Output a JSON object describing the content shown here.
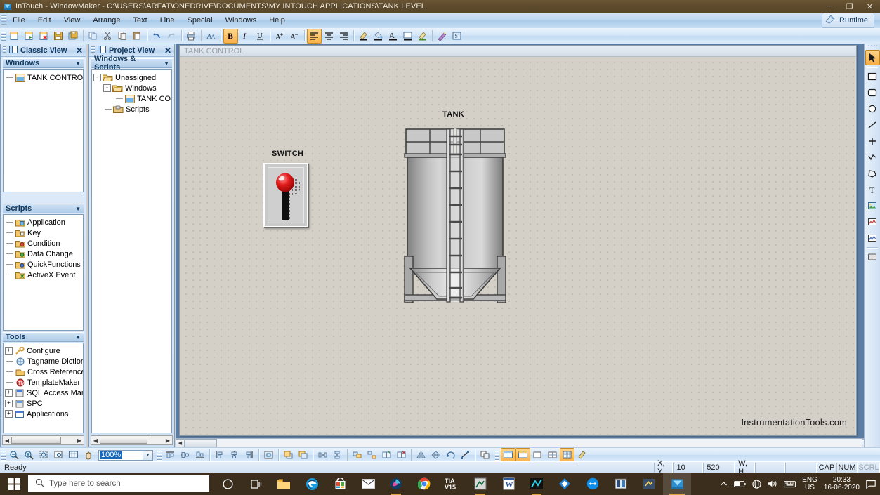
{
  "window": {
    "title": "InTouch - WindowMaker - C:\\USERS\\ARFAT\\ONEDRIVE\\DOCUMENTS\\MY INTOUCH APPLICATIONS\\TANK LEVEL",
    "minimize": "─",
    "maximize": "❐",
    "close": "✕"
  },
  "menu": {
    "items": [
      {
        "label": "File"
      },
      {
        "label": "Edit"
      },
      {
        "label": "View"
      },
      {
        "label": "Arrange"
      },
      {
        "label": "Text"
      },
      {
        "label": "Line"
      },
      {
        "label": "Special"
      },
      {
        "label": "Windows"
      },
      {
        "label": "Help"
      }
    ],
    "runtime_label": "Runtime"
  },
  "toolbar": {
    "groups": [
      {
        "buttons": [
          {
            "name": "new-window-button",
            "icon": "new-window-icon"
          },
          {
            "name": "open-window-button",
            "icon": "open-window-icon"
          },
          {
            "name": "close-window-button",
            "icon": "close-window-icon"
          },
          {
            "name": "save-button",
            "icon": "save-icon"
          },
          {
            "name": "save-all-button",
            "icon": "save-all-icon"
          }
        ]
      },
      {
        "buttons": [
          {
            "name": "duplicate-button",
            "icon": "duplicate-icon"
          },
          {
            "name": "cut-button",
            "icon": "cut-icon"
          },
          {
            "name": "copy-button",
            "icon": "copy-icon"
          },
          {
            "name": "paste-button",
            "icon": "paste-icon"
          }
        ]
      },
      {
        "buttons": [
          {
            "name": "undo-button",
            "icon": "undo-icon"
          },
          {
            "name": "redo-button",
            "icon": "redo-icon"
          }
        ]
      },
      {
        "buttons": [
          {
            "name": "print-button",
            "icon": "print-icon"
          }
        ]
      },
      {
        "buttons": [
          {
            "name": "font-button",
            "icon": "font-icon"
          }
        ]
      },
      {
        "buttons": [
          {
            "name": "bold-button",
            "icon": "bold-icon",
            "label": "B",
            "active": true
          },
          {
            "name": "italic-button",
            "icon": "italic-icon",
            "label": "I"
          },
          {
            "name": "underline-button",
            "icon": "underline-icon",
            "label": "U"
          }
        ]
      },
      {
        "buttons": [
          {
            "name": "increase-font-button",
            "icon": "font-grow-icon",
            "label": "A"
          },
          {
            "name": "decrease-font-button",
            "icon": "font-shrink-icon",
            "label": "A"
          }
        ]
      },
      {
        "buttons": [
          {
            "name": "align-left-button",
            "icon": "align-left-icon",
            "active": true
          },
          {
            "name": "align-center-button",
            "icon": "align-center-icon"
          },
          {
            "name": "align-right-button",
            "icon": "align-right-icon"
          }
        ]
      },
      {
        "buttons": [
          {
            "name": "line-color-button",
            "icon": "line-color-icon"
          },
          {
            "name": "fill-color-button",
            "icon": "fill-color-icon"
          },
          {
            "name": "text-color-button",
            "icon": "text-color-icon"
          },
          {
            "name": "window-color-button",
            "icon": "window-color-icon"
          },
          {
            "name": "highlight-color-button",
            "icon": "highlight-color-icon"
          }
        ]
      },
      {
        "buttons": [
          {
            "name": "wizard-button",
            "icon": "wizard-icon"
          },
          {
            "name": "symbol-factory-button",
            "icon": "symbol-factory-icon"
          }
        ]
      }
    ]
  },
  "classic_view": {
    "title": "Classic View",
    "close_label": "✕",
    "windows_section": {
      "title": "Windows",
      "arrow": "▼",
      "items": [
        {
          "label": "TANK CONTROL",
          "icon": "window-icon"
        }
      ]
    },
    "scripts_section": {
      "title": "Scripts",
      "arrow": "▼",
      "items": [
        {
          "label": "Application",
          "icon": "script-application-icon"
        },
        {
          "label": "Key",
          "icon": "script-key-icon"
        },
        {
          "label": "Condition",
          "icon": "script-condition-icon"
        },
        {
          "label": "Data Change",
          "icon": "script-data-change-icon"
        },
        {
          "label": "QuickFunctions",
          "icon": "script-quickfunctions-icon"
        },
        {
          "label": "ActiveX Event",
          "icon": "script-activex-icon"
        }
      ]
    },
    "tools_section": {
      "title": "Tools",
      "arrow": "▼",
      "items": [
        {
          "label": "Configure",
          "icon": "configure-icon",
          "expandable": true
        },
        {
          "label": "Tagname Dictiona",
          "icon": "tagname-dictionary-icon",
          "expandable": false
        },
        {
          "label": "Cross Reference",
          "icon": "cross-reference-icon",
          "expandable": false
        },
        {
          "label": "TemplateMaker",
          "icon": "template-maker-icon",
          "expandable": false
        },
        {
          "label": "SQL Access Mana",
          "icon": "sql-access-icon",
          "expandable": true
        },
        {
          "label": "SPC",
          "icon": "spc-icon",
          "expandable": true
        },
        {
          "label": "Applications",
          "icon": "applications-icon",
          "expandable": true
        }
      ]
    }
  },
  "project_view": {
    "title": "Project View",
    "close_label": "✕",
    "section": {
      "title": "Windows & Scripts",
      "arrow": "▼"
    },
    "tree": [
      {
        "label": "Unassigned",
        "icon": "folder-open-icon",
        "depth": 0,
        "expander": "-"
      },
      {
        "label": "Windows",
        "icon": "folder-open-icon",
        "depth": 1,
        "expander": "-"
      },
      {
        "label": "TANK CON",
        "icon": "window-icon",
        "depth": 2,
        "expander": ""
      },
      {
        "label": "Scripts",
        "icon": "folder-scripts-icon",
        "depth": 1,
        "expander": ""
      }
    ]
  },
  "document": {
    "window_title": "TANK CONTROL",
    "watermark": "InstrumentationTools.com",
    "objects": [
      {
        "name": "switch-label",
        "label": "SWITCH"
      },
      {
        "name": "tank-label",
        "label": "TANK"
      }
    ]
  },
  "palette": {
    "tools": [
      {
        "name": "select-tool",
        "icon": "arrow-cursor-icon",
        "active": true
      },
      {
        "name": "rectangle-tool",
        "icon": "rectangle-icon"
      },
      {
        "name": "rounded-rectangle-tool",
        "icon": "rounded-rectangle-icon"
      },
      {
        "name": "ellipse-tool",
        "icon": "ellipse-icon"
      },
      {
        "name": "line-tool",
        "icon": "line-icon"
      },
      {
        "name": "h-v-line-tool",
        "icon": "cross-line-icon"
      },
      {
        "name": "polyline-tool",
        "icon": "polyline-icon"
      },
      {
        "name": "polygon-tool",
        "icon": "polygon-icon"
      },
      {
        "name": "text-tool",
        "icon": "text-t-icon"
      },
      {
        "name": "bitmap-tool",
        "icon": "bitmap-image-icon"
      },
      {
        "name": "realtime-trend-tool",
        "icon": "realtime-trend-icon"
      },
      {
        "name": "historical-trend-tool",
        "icon": "historical-trend-icon"
      },
      {
        "name": "button-tool",
        "icon": "button-icon"
      }
    ]
  },
  "bottom_toolbar": {
    "zoom": {
      "value": "100%",
      "drop_arrow": "▾"
    },
    "view_buttons": [
      {
        "name": "zoom-out-button",
        "icon": "zoom-out-icon"
      },
      {
        "name": "zoom-in-button",
        "icon": "zoom-in-icon"
      },
      {
        "name": "zoom-selection-button",
        "icon": "zoom-selection-icon"
      },
      {
        "name": "zoom-window-button",
        "icon": "zoom-window-icon"
      },
      {
        "name": "zoom-fit-button",
        "icon": "zoom-fit-icon"
      },
      {
        "name": "pan-button",
        "icon": "hand-pan-icon"
      }
    ],
    "align_buttons": [
      {
        "name": "align-top-button",
        "icon": "align-top-icon"
      },
      {
        "name": "align-middle-button",
        "icon": "align-middle-icon"
      },
      {
        "name": "align-bottom-button",
        "icon": "align-bottom-icon"
      },
      {
        "name": "align-edge-left-button",
        "icon": "align-edge-left-icon"
      },
      {
        "name": "align-center-h-button",
        "icon": "align-center-h-icon"
      },
      {
        "name": "align-edge-right-button",
        "icon": "align-edge-right-icon"
      },
      {
        "name": "center-button",
        "icon": "center-icon"
      },
      {
        "name": "bring-to-front-button",
        "icon": "bring-front-icon"
      },
      {
        "name": "send-to-back-button",
        "icon": "send-back-icon"
      },
      {
        "name": "space-horizontal-button",
        "icon": "space-horizontal-icon"
      },
      {
        "name": "space-vertical-button",
        "icon": "space-vertical-icon"
      },
      {
        "name": "make-symbol-button",
        "icon": "make-symbol-icon"
      },
      {
        "name": "break-symbol-button",
        "icon": "break-symbol-icon"
      },
      {
        "name": "make-cell-button",
        "icon": "make-cell-icon"
      },
      {
        "name": "break-cell-button",
        "icon": "break-cell-icon"
      },
      {
        "name": "flip-horizontal-button",
        "icon": "flip-horizontal-icon"
      },
      {
        "name": "flip-vertical-button",
        "icon": "flip-vertical-icon"
      },
      {
        "name": "rotate-button",
        "icon": "rotate-icon"
      },
      {
        "name": "reshape-button",
        "icon": "reshape-icon"
      },
      {
        "name": "duplicate-object-button",
        "icon": "duplicate-object-icon"
      }
    ],
    "window_buttons": [
      {
        "name": "tile-vertical-button",
        "icon": "tile-vertical-icon",
        "active": true
      },
      {
        "name": "tile-horizontal-button",
        "icon": "tile-horizontal-icon",
        "active": true
      },
      {
        "name": "cascade-button",
        "icon": "cascade-icon"
      },
      {
        "name": "arrange-icons-button",
        "icon": "arrange-icons-icon"
      },
      {
        "name": "grid-toggle-button",
        "icon": "grid-icon",
        "active": true
      },
      {
        "name": "grid-settings-button",
        "icon": "grid-settings-icon"
      }
    ]
  },
  "status_bar": {
    "message": "Ready",
    "xy_label": "X, Y",
    "x_value": "10",
    "y_value": "520",
    "wh_label": "W, H",
    "w_value": "",
    "h_value": "",
    "caps": "CAP",
    "num": "NUM",
    "scroll": "SCRL"
  },
  "taskbar": {
    "start": "start-icon",
    "search_placeholder": "Type here to search",
    "apps": [
      {
        "name": "cortana-icon"
      },
      {
        "name": "task-view-icon"
      },
      {
        "name": "file-explorer-icon"
      },
      {
        "name": "microsoft-edge-icon"
      },
      {
        "name": "microsoft-store-icon"
      },
      {
        "name": "mail-icon"
      },
      {
        "name": "paint-3d-icon"
      },
      {
        "name": "google-chrome-icon"
      },
      {
        "name": "tia-portal-v15-icon",
        "label": "TIA\nV15"
      },
      {
        "name": "step7-icon"
      },
      {
        "name": "microsoft-word-icon"
      },
      {
        "name": "wincc-icon"
      },
      {
        "name": "autocad-icon"
      },
      {
        "name": "teamviewer-icon"
      },
      {
        "name": "simatic-manager-icon"
      },
      {
        "name": "logix-designer-icon"
      },
      {
        "name": "intouch-windowmaker-icon"
      }
    ],
    "tray": {
      "chevron": "⌃",
      "battery": "battery-icon",
      "network": "network-icon",
      "volume": "volume-icon",
      "keyboard": "keyboard-icon",
      "lang_line1": "ENG",
      "lang_line2": "US",
      "time": "20:33",
      "date": "16-06-2020",
      "notifications": "notification-icon"
    }
  }
}
